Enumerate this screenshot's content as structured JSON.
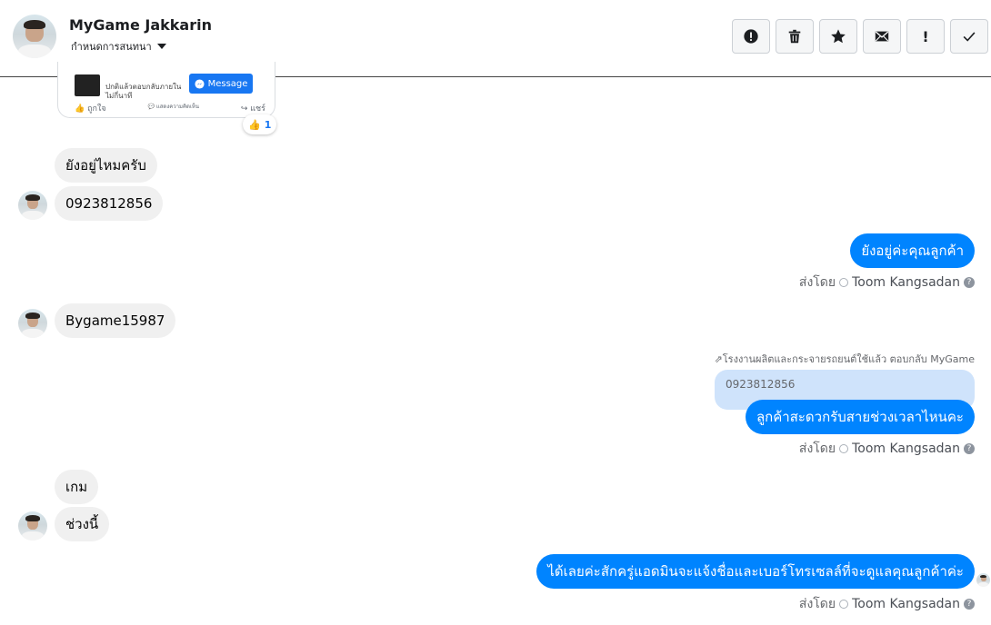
{
  "header": {
    "name": "MyGame Jakkarin",
    "subtitle": "กำหนดการสนทนา",
    "toolbar": [
      {
        "name": "mark-spam-button",
        "icon": "alert-circle-icon",
        "glyph": "!"
      },
      {
        "name": "delete-button",
        "icon": "trash-icon",
        "glyph": ""
      },
      {
        "name": "star-button",
        "icon": "star-icon",
        "glyph": "★"
      },
      {
        "name": "mark-unread-button",
        "icon": "envelope-icon",
        "glyph": "✉"
      },
      {
        "name": "follow-up-button",
        "icon": "exclamation-icon",
        "glyph": "!"
      },
      {
        "name": "mark-done-button",
        "icon": "check-icon",
        "glyph": "✓"
      }
    ]
  },
  "post_card": {
    "line1": "ปกติแล้วตอบกลับภายใน",
    "line2": "ไม่กี่นาที",
    "message_button": "Message",
    "like": "ถูกใจ",
    "comment": "แสดงความคิดเห็น",
    "share": "แชร์",
    "reaction_count": "1"
  },
  "messages": {
    "in1": "ยังอยู่ไหมครับ",
    "in2": "0923812856",
    "out1": "ยังอยู่ค่ะคุณลูกค้า",
    "in3": "Bygame15987",
    "reply_label": "โรงงานผลิตและกระจายรถยนต์ใช้แล้ว ตอบกลับ MyGame",
    "quoted": "0923812856",
    "out2": "ลูกค้าสะดวกรับสายช่วงเวลาไหนคะ",
    "in4": "เกม",
    "in5": "ช่วงนี้",
    "out3": "ได้เลยค่ะสักครู่แอดมินจะแจ้งชื่อและเบอร์โทรเซลล์ที่จะดูแลคุณลูกค้าค่ะ"
  },
  "sent_by": {
    "label": "ส่งโดย",
    "agent": "Toom Kangsadan"
  },
  "colors": {
    "outgoing": "#0084ff",
    "incoming": "#f0f0f0",
    "quoted": "#cfe3fb"
  }
}
